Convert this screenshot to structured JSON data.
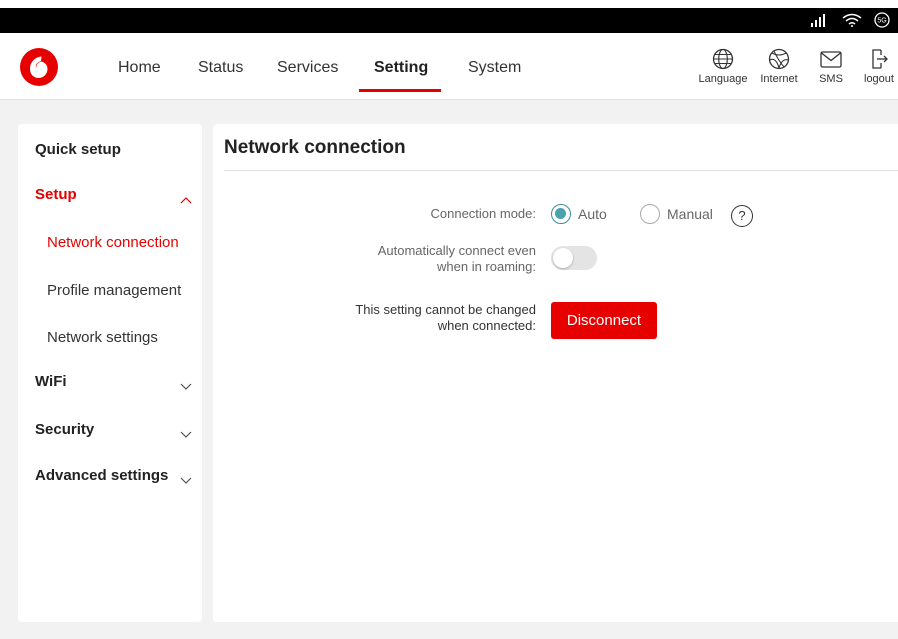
{
  "nav": {
    "items": [
      {
        "label": "Home"
      },
      {
        "label": "Status"
      },
      {
        "label": "Services"
      },
      {
        "label": "Setting"
      },
      {
        "label": "System"
      }
    ],
    "active": "Setting",
    "tools": [
      {
        "label": "Language",
        "icon": "globe-icon"
      },
      {
        "label": "Internet",
        "icon": "internet-icon"
      },
      {
        "label": "SMS",
        "icon": "envelope-icon"
      },
      {
        "label": "logout",
        "icon": "logout-icon"
      }
    ]
  },
  "statusbar": {
    "network_badge": "5G"
  },
  "sidebar": {
    "quick_setup": "Quick setup",
    "setup": "Setup",
    "setup_items": [
      "Network connection",
      "Profile management",
      "Network settings"
    ],
    "wifi": "WiFi",
    "security": "Security",
    "advanced": "Advanced settings"
  },
  "main": {
    "title": "Network connection",
    "connection_mode_label": "Connection mode:",
    "mode_auto": "Auto",
    "mode_manual": "Manual",
    "help_glyph": "?",
    "roaming_label_1": "Automatically connect even",
    "roaming_label_2": "when in roaming:",
    "locked_label_1": "This setting cannot be changed",
    "locked_label_2": "when connected:",
    "disconnect_label": "Disconnect"
  },
  "colors": {
    "brand_red": "#e60000",
    "radio_selected": "#4aa0ac"
  }
}
